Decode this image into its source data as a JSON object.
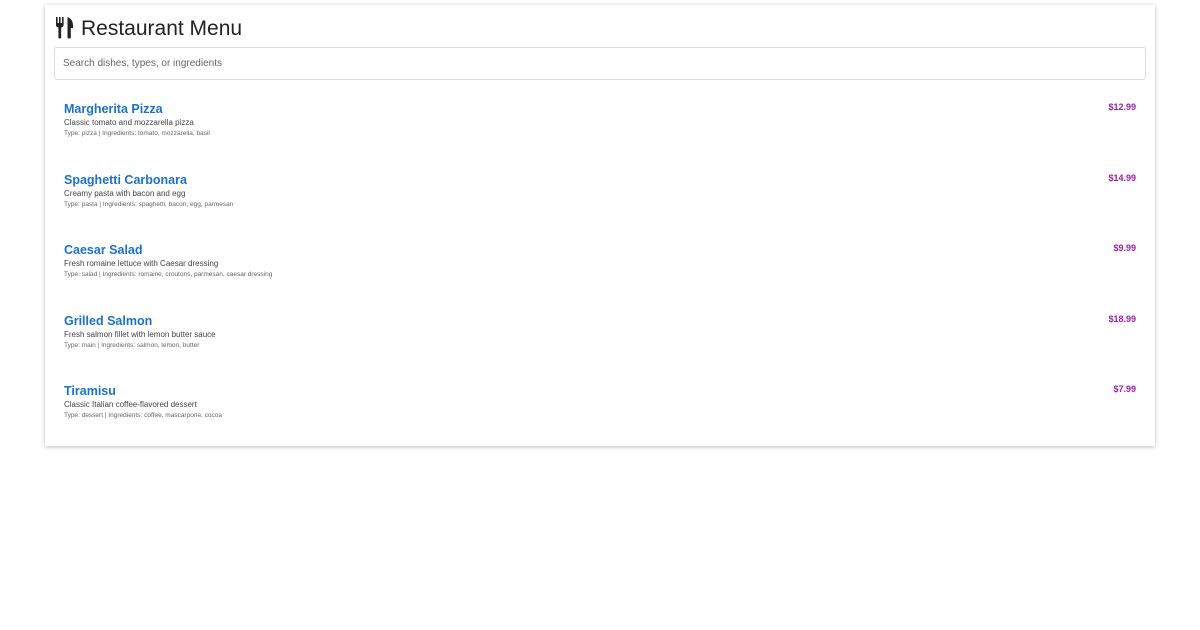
{
  "header": {
    "icon": "fork-knife-icon",
    "title": "Restaurant Menu"
  },
  "search": {
    "placeholder": "Search dishes, types, or ingredients",
    "value": ""
  },
  "colors": {
    "name": "#1a73c9",
    "price": "#9b1fa6"
  },
  "menu": {
    "items": [
      {
        "name": "Margherita Pizza",
        "price": "$12.99",
        "description": "Classic tomato and mozzarella pizza",
        "meta": "Type: pizza | Ingredients: tomato, mozzarella, basil"
      },
      {
        "name": "Spaghetti Carbonara",
        "price": "$14.99",
        "description": "Creamy pasta with bacon and egg",
        "meta": "Type: pasta | Ingredients: spaghetti, bacon, egg, parmesan"
      },
      {
        "name": "Caesar Salad",
        "price": "$9.99",
        "description": "Fresh romaine lettuce with Caesar dressing",
        "meta": "Type: salad | Ingredients: romaine, croutons, parmesan, caesar dressing"
      },
      {
        "name": "Grilled Salmon",
        "price": "$18.99",
        "description": "Fresh salmon fillet with lemon butter sauce",
        "meta": "Type: main | Ingredients: salmon, lemon, butter"
      },
      {
        "name": "Tiramisu",
        "price": "$7.99",
        "description": "Classic Italian coffee-flavored dessert",
        "meta": "Type: dessert | Ingredients: coffee, mascarpone, cocoa"
      }
    ]
  }
}
